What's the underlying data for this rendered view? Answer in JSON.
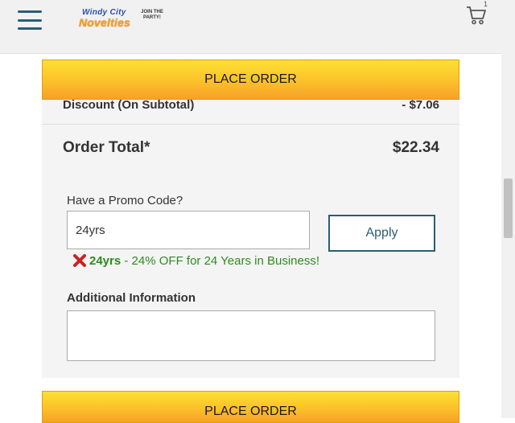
{
  "header": {
    "logo_line1": "Windy City",
    "logo_line2": "Novelties",
    "logo_tagline": "JOIN THE PARTY!",
    "cart_count": "1"
  },
  "checkout": {
    "place_order_label": "PLACE ORDER",
    "discount_label": "Discount (On Subtotal)",
    "discount_value": "- $7.06",
    "total_label": "Order Total*",
    "total_value": "$22.34",
    "promo": {
      "label": "Have a Promo Code?",
      "value": "24yrs",
      "apply_label": "Apply",
      "applied_code": "24yrs",
      "applied_desc": " - 24% OFF for 24 Years in Business!"
    },
    "additional_info_label": "Additional Information",
    "additional_info_value": ""
  },
  "colors": {
    "accent": "#2a5d73",
    "button_yellow": "#fbc12a",
    "success_green": "#2e8b1f",
    "remove_red": "#d02020"
  },
  "icons": {
    "menu": "hamburger-icon",
    "cart": "cart-icon",
    "remove": "close-icon"
  }
}
